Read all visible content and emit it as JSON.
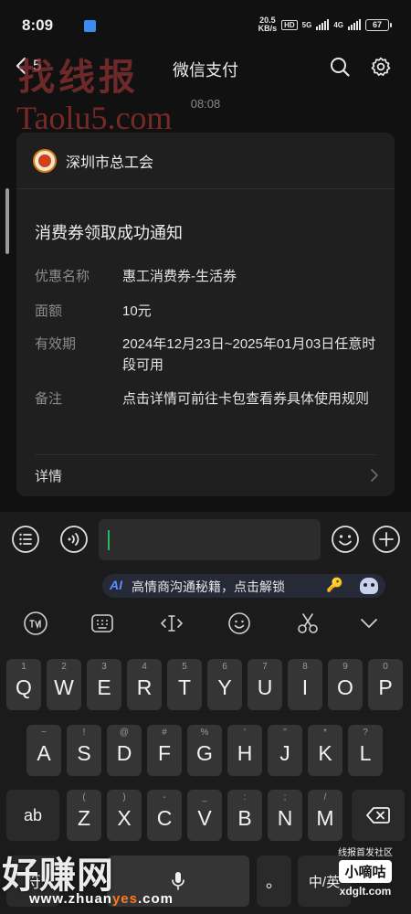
{
  "status_bar": {
    "time": "8:09",
    "net_speed_value": "20.5",
    "net_speed_unit": "KB/s",
    "hd_label": "HD",
    "network_5g": "5G",
    "network_4g": "4G",
    "battery": "67"
  },
  "header": {
    "back_count": "5",
    "title": "微信支付"
  },
  "watermarks": {
    "top_cn": "找线报",
    "top_en": "Taolu5.com",
    "bottom_cn": "好赚网",
    "bottom_url_prefix": "www.zhuan",
    "bottom_url_highlight": "yes",
    "bottom_url_suffix": ".com",
    "corner_title": "线报首发社区",
    "corner_brand": "小嘀咕",
    "corner_url": "xdglt.com"
  },
  "chat": {
    "timestamp": "08:08"
  },
  "card": {
    "org_name": "深圳市总工会",
    "title": "消费券领取成功通知",
    "rows": [
      {
        "key": "优惠名称",
        "value": "惠工消费券-生活券"
      },
      {
        "key": "面额",
        "value": "10元"
      },
      {
        "key": "有效期",
        "value": "2024年12月23日~2025年01月03日任意时段可用"
      },
      {
        "key": "备注",
        "value": "点击详情可前往卡包查看券具体使用规则"
      }
    ],
    "detail_label": "详情"
  },
  "input_bar": {
    "text_value": ""
  },
  "ai_banner": {
    "tag": "AI",
    "text": "高情商沟通秘籍，点击解锁",
    "emoji": "🔑"
  },
  "keyboard": {
    "row1": [
      {
        "main": "Q",
        "sub": "1"
      },
      {
        "main": "W",
        "sub": "2"
      },
      {
        "main": "E",
        "sub": "3"
      },
      {
        "main": "R",
        "sub": "4"
      },
      {
        "main": "T",
        "sub": "5"
      },
      {
        "main": "Y",
        "sub": "6"
      },
      {
        "main": "U",
        "sub": "7"
      },
      {
        "main": "I",
        "sub": "8"
      },
      {
        "main": "O",
        "sub": "9"
      },
      {
        "main": "P",
        "sub": "0"
      }
    ],
    "row2": [
      {
        "main": "A",
        "sub": "~"
      },
      {
        "main": "S",
        "sub": "!"
      },
      {
        "main": "D",
        "sub": "@"
      },
      {
        "main": "F",
        "sub": "#"
      },
      {
        "main": "G",
        "sub": "%"
      },
      {
        "main": "H",
        "sub": "'"
      },
      {
        "main": "J",
        "sub": "\""
      },
      {
        "main": "K",
        "sub": "*"
      },
      {
        "main": "L",
        "sub": "?"
      }
    ],
    "row3": [
      {
        "main": "Z",
        "sub": "("
      },
      {
        "main": "X",
        "sub": ")"
      },
      {
        "main": "C",
        "sub": "-"
      },
      {
        "main": "V",
        "sub": "_"
      },
      {
        "main": "B",
        "sub": ":"
      },
      {
        "main": "N",
        "sub": ";"
      },
      {
        "main": "M",
        "sub": "/"
      }
    ],
    "ab_label": "ab",
    "symbol_label": "符",
    "period_label": "。",
    "lang_label": "中/英"
  }
}
